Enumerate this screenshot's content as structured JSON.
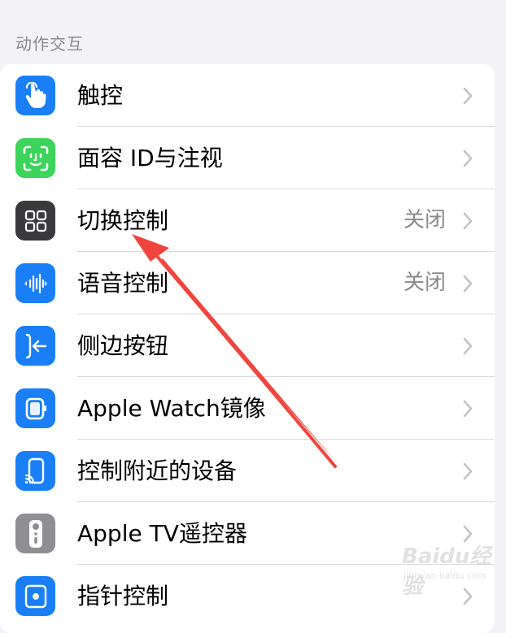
{
  "section": {
    "title": "动作交互"
  },
  "rows": [
    {
      "label": "触控",
      "value": "",
      "icon": "hand-tap-icon",
      "color": "#1a7ff6"
    },
    {
      "label": "面容 ID与注视",
      "value": "",
      "icon": "face-id-icon",
      "color": "#3dd45b"
    },
    {
      "label": "切换控制",
      "value": "关闭",
      "icon": "switch-control-icon",
      "color": "#3a3a3c"
    },
    {
      "label": "语音控制",
      "value": "关闭",
      "icon": "voice-control-icon",
      "color": "#1a7ff6"
    },
    {
      "label": "侧边按钮",
      "value": "",
      "icon": "side-button-icon",
      "color": "#1a7ff6"
    },
    {
      "label": "Apple Watch镜像",
      "value": "",
      "icon": "watch-icon",
      "color": "#1a7ff6"
    },
    {
      "label": "控制附近的设备",
      "value": "",
      "icon": "nearby-device-icon",
      "color": "#1a7ff6"
    },
    {
      "label": "Apple TV遥控器",
      "value": "",
      "icon": "tv-remote-icon",
      "color": "#8e8e93"
    },
    {
      "label": "指针控制",
      "value": "",
      "icon": "pointer-control-icon",
      "color": "#1a7ff6"
    }
  ],
  "watermark": {
    "brand": "Baidu经验",
    "url": "jingyan.baidu.com"
  },
  "colors": {
    "annotation_arrow": "#f0453f",
    "background": "#f2f2f7"
  }
}
